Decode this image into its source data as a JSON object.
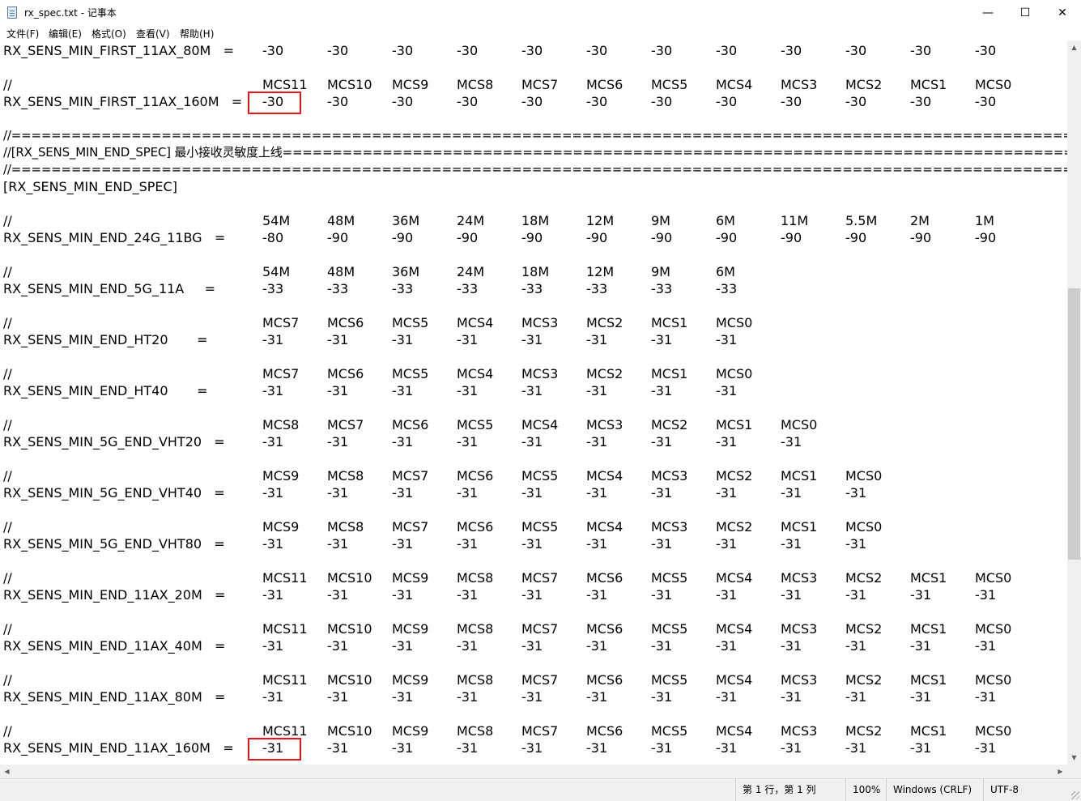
{
  "window": {
    "title": "rx_spec.txt - 记事本",
    "minimize_glyph": "—",
    "maximize_glyph": "☐",
    "close_glyph": "✕"
  },
  "menu": [
    "文件(F)",
    "编辑(E)",
    "格式(O)",
    "查看(V)",
    "帮助(H)"
  ],
  "editor": {
    "lines": [
      {
        "label": "RX_SENS_MIN_FIRST_11AX_80M   =",
        "values": [
          "-30",
          "-30",
          "-30",
          "-30",
          "-30",
          "-30",
          "-30",
          "-30",
          "-30",
          "-30",
          "-30",
          "-30"
        ]
      },
      {
        "label": "",
        "values": []
      },
      {
        "label": "//",
        "values": [
          "MCS11",
          "MCS10",
          "MCS9",
          "MCS8",
          "MCS7",
          "MCS6",
          "MCS5",
          "MCS4",
          "MCS3",
          "MCS2",
          "MCS1",
          "MCS0"
        ]
      },
      {
        "label": "RX_SENS_MIN_FIRST_11AX_160M   =",
        "values": [
          "-30",
          "-30",
          "-30",
          "-30",
          "-30",
          "-30",
          "-30",
          "-30",
          "-30",
          "-30",
          "-30",
          "-30"
        ]
      },
      {
        "label": "",
        "values": []
      },
      {
        "label": "//=====================================================================================================================",
        "values": [],
        "sep": true
      },
      {
        "label": "//[RX_SENS_MIN_END_SPEC] 最小接收灵敏度上线====================================================================================",
        "values": [],
        "sep": true
      },
      {
        "label": "//=====================================================================================================================",
        "values": [],
        "sep": true
      },
      {
        "label": "[RX_SENS_MIN_END_SPEC]",
        "values": []
      },
      {
        "label": "",
        "values": []
      },
      {
        "label": "//",
        "values": [
          "54M",
          "48M",
          "36M",
          "24M",
          "18M",
          "12M",
          "9M",
          "6M",
          "11M",
          "5.5M",
          "2M",
          "1M"
        ]
      },
      {
        "label": "RX_SENS_MIN_END_24G_11BG   =",
        "values": [
          "-80",
          "-90",
          "-90",
          "-90",
          "-90",
          "-90",
          "-90",
          "-90",
          "-90",
          "-90",
          "-90",
          "-90"
        ]
      },
      {
        "label": "",
        "values": []
      },
      {
        "label": "//",
        "values": [
          "54M",
          "48M",
          "36M",
          "24M",
          "18M",
          "12M",
          "9M",
          "6M"
        ]
      },
      {
        "label": "RX_SENS_MIN_END_5G_11A     =",
        "values": [
          "-33",
          "-33",
          "-33",
          "-33",
          "-33",
          "-33",
          "-33",
          "-33"
        ]
      },
      {
        "label": "",
        "values": []
      },
      {
        "label": "//",
        "values": [
          "MCS7",
          "MCS6",
          "MCS5",
          "MCS4",
          "MCS3",
          "MCS2",
          "MCS1",
          "MCS0"
        ]
      },
      {
        "label": "RX_SENS_MIN_END_HT20       =",
        "values": [
          "-31",
          "-31",
          "-31",
          "-31",
          "-31",
          "-31",
          "-31",
          "-31"
        ]
      },
      {
        "label": "",
        "values": []
      },
      {
        "label": "//",
        "values": [
          "MCS7",
          "MCS6",
          "MCS5",
          "MCS4",
          "MCS3",
          "MCS2",
          "MCS1",
          "MCS0"
        ]
      },
      {
        "label": "RX_SENS_MIN_END_HT40       =",
        "values": [
          "-31",
          "-31",
          "-31",
          "-31",
          "-31",
          "-31",
          "-31",
          "-31"
        ]
      },
      {
        "label": "",
        "values": []
      },
      {
        "label": "//",
        "values": [
          "MCS8",
          "MCS7",
          "MCS6",
          "MCS5",
          "MCS4",
          "MCS3",
          "MCS2",
          "MCS1",
          "MCS0"
        ]
      },
      {
        "label": "RX_SENS_MIN_5G_END_VHT20   =",
        "values": [
          "-31",
          "-31",
          "-31",
          "-31",
          "-31",
          "-31",
          "-31",
          "-31",
          "-31"
        ]
      },
      {
        "label": "",
        "values": []
      },
      {
        "label": "//",
        "values": [
          "MCS9",
          "MCS8",
          "MCS7",
          "MCS6",
          "MCS5",
          "MCS4",
          "MCS3",
          "MCS2",
          "MCS1",
          "MCS0"
        ]
      },
      {
        "label": "RX_SENS_MIN_5G_END_VHT40   =",
        "values": [
          "-31",
          "-31",
          "-31",
          "-31",
          "-31",
          "-31",
          "-31",
          "-31",
          "-31",
          "-31"
        ]
      },
      {
        "label": "",
        "values": []
      },
      {
        "label": "//",
        "values": [
          "MCS9",
          "MCS8",
          "MCS7",
          "MCS6",
          "MCS5",
          "MCS4",
          "MCS3",
          "MCS2",
          "MCS1",
          "MCS0"
        ]
      },
      {
        "label": "RX_SENS_MIN_5G_END_VHT80   =",
        "values": [
          "-31",
          "-31",
          "-31",
          "-31",
          "-31",
          "-31",
          "-31",
          "-31",
          "-31",
          "-31"
        ]
      },
      {
        "label": "",
        "values": []
      },
      {
        "label": "//",
        "values": [
          "MCS11",
          "MCS10",
          "MCS9",
          "MCS8",
          "MCS7",
          "MCS6",
          "MCS5",
          "MCS4",
          "MCS3",
          "MCS2",
          "MCS1",
          "MCS0"
        ]
      },
      {
        "label": "RX_SENS_MIN_END_11AX_20M   =",
        "values": [
          "-31",
          "-31",
          "-31",
          "-31",
          "-31",
          "-31",
          "-31",
          "-31",
          "-31",
          "-31",
          "-31",
          "-31"
        ]
      },
      {
        "label": "",
        "values": []
      },
      {
        "label": "//",
        "values": [
          "MCS11",
          "MCS10",
          "MCS9",
          "MCS8",
          "MCS7",
          "MCS6",
          "MCS5",
          "MCS4",
          "MCS3",
          "MCS2",
          "MCS1",
          "MCS0"
        ]
      },
      {
        "label": "RX_SENS_MIN_END_11AX_40M   =",
        "values": [
          "-31",
          "-31",
          "-31",
          "-31",
          "-31",
          "-31",
          "-31",
          "-31",
          "-31",
          "-31",
          "-31",
          "-31"
        ]
      },
      {
        "label": "",
        "values": []
      },
      {
        "label": "//",
        "values": [
          "MCS11",
          "MCS10",
          "MCS9",
          "MCS8",
          "MCS7",
          "MCS6",
          "MCS5",
          "MCS4",
          "MCS3",
          "MCS2",
          "MCS1",
          "MCS0"
        ]
      },
      {
        "label": "RX_SENS_MIN_END_11AX_80M   =",
        "values": [
          "-31",
          "-31",
          "-31",
          "-31",
          "-31",
          "-31",
          "-31",
          "-31",
          "-31",
          "-31",
          "-31",
          "-31"
        ]
      },
      {
        "label": "",
        "values": []
      },
      {
        "label": "//",
        "values": [
          "MCS11",
          "MCS10",
          "MCS9",
          "MCS8",
          "MCS7",
          "MCS6",
          "MCS5",
          "MCS4",
          "MCS3",
          "MCS2",
          "MCS1",
          "MCS0"
        ]
      },
      {
        "label": "RX_SENS_MIN_END_11AX_160M   =",
        "values": [
          "-31",
          "-31",
          "-31",
          "-31",
          "-31",
          "-31",
          "-31",
          "-31",
          "-31",
          "-31",
          "-31",
          "-31"
        ]
      }
    ],
    "highlighted_cells": [
      {
        "line": 3,
        "col": 0
      },
      {
        "line": 41,
        "col": 0
      }
    ],
    "highlight_color": "#e8131b"
  },
  "status": {
    "position": "第 1 行，第 1 列",
    "zoom": "100%",
    "line_ending": "Windows (CRLF)",
    "encoding": "UTF-8"
  },
  "icons": {
    "app": "notepad-icon",
    "scroll_up": "▲",
    "scroll_down": "▼",
    "scroll_left": "◀",
    "scroll_right": "▶"
  }
}
